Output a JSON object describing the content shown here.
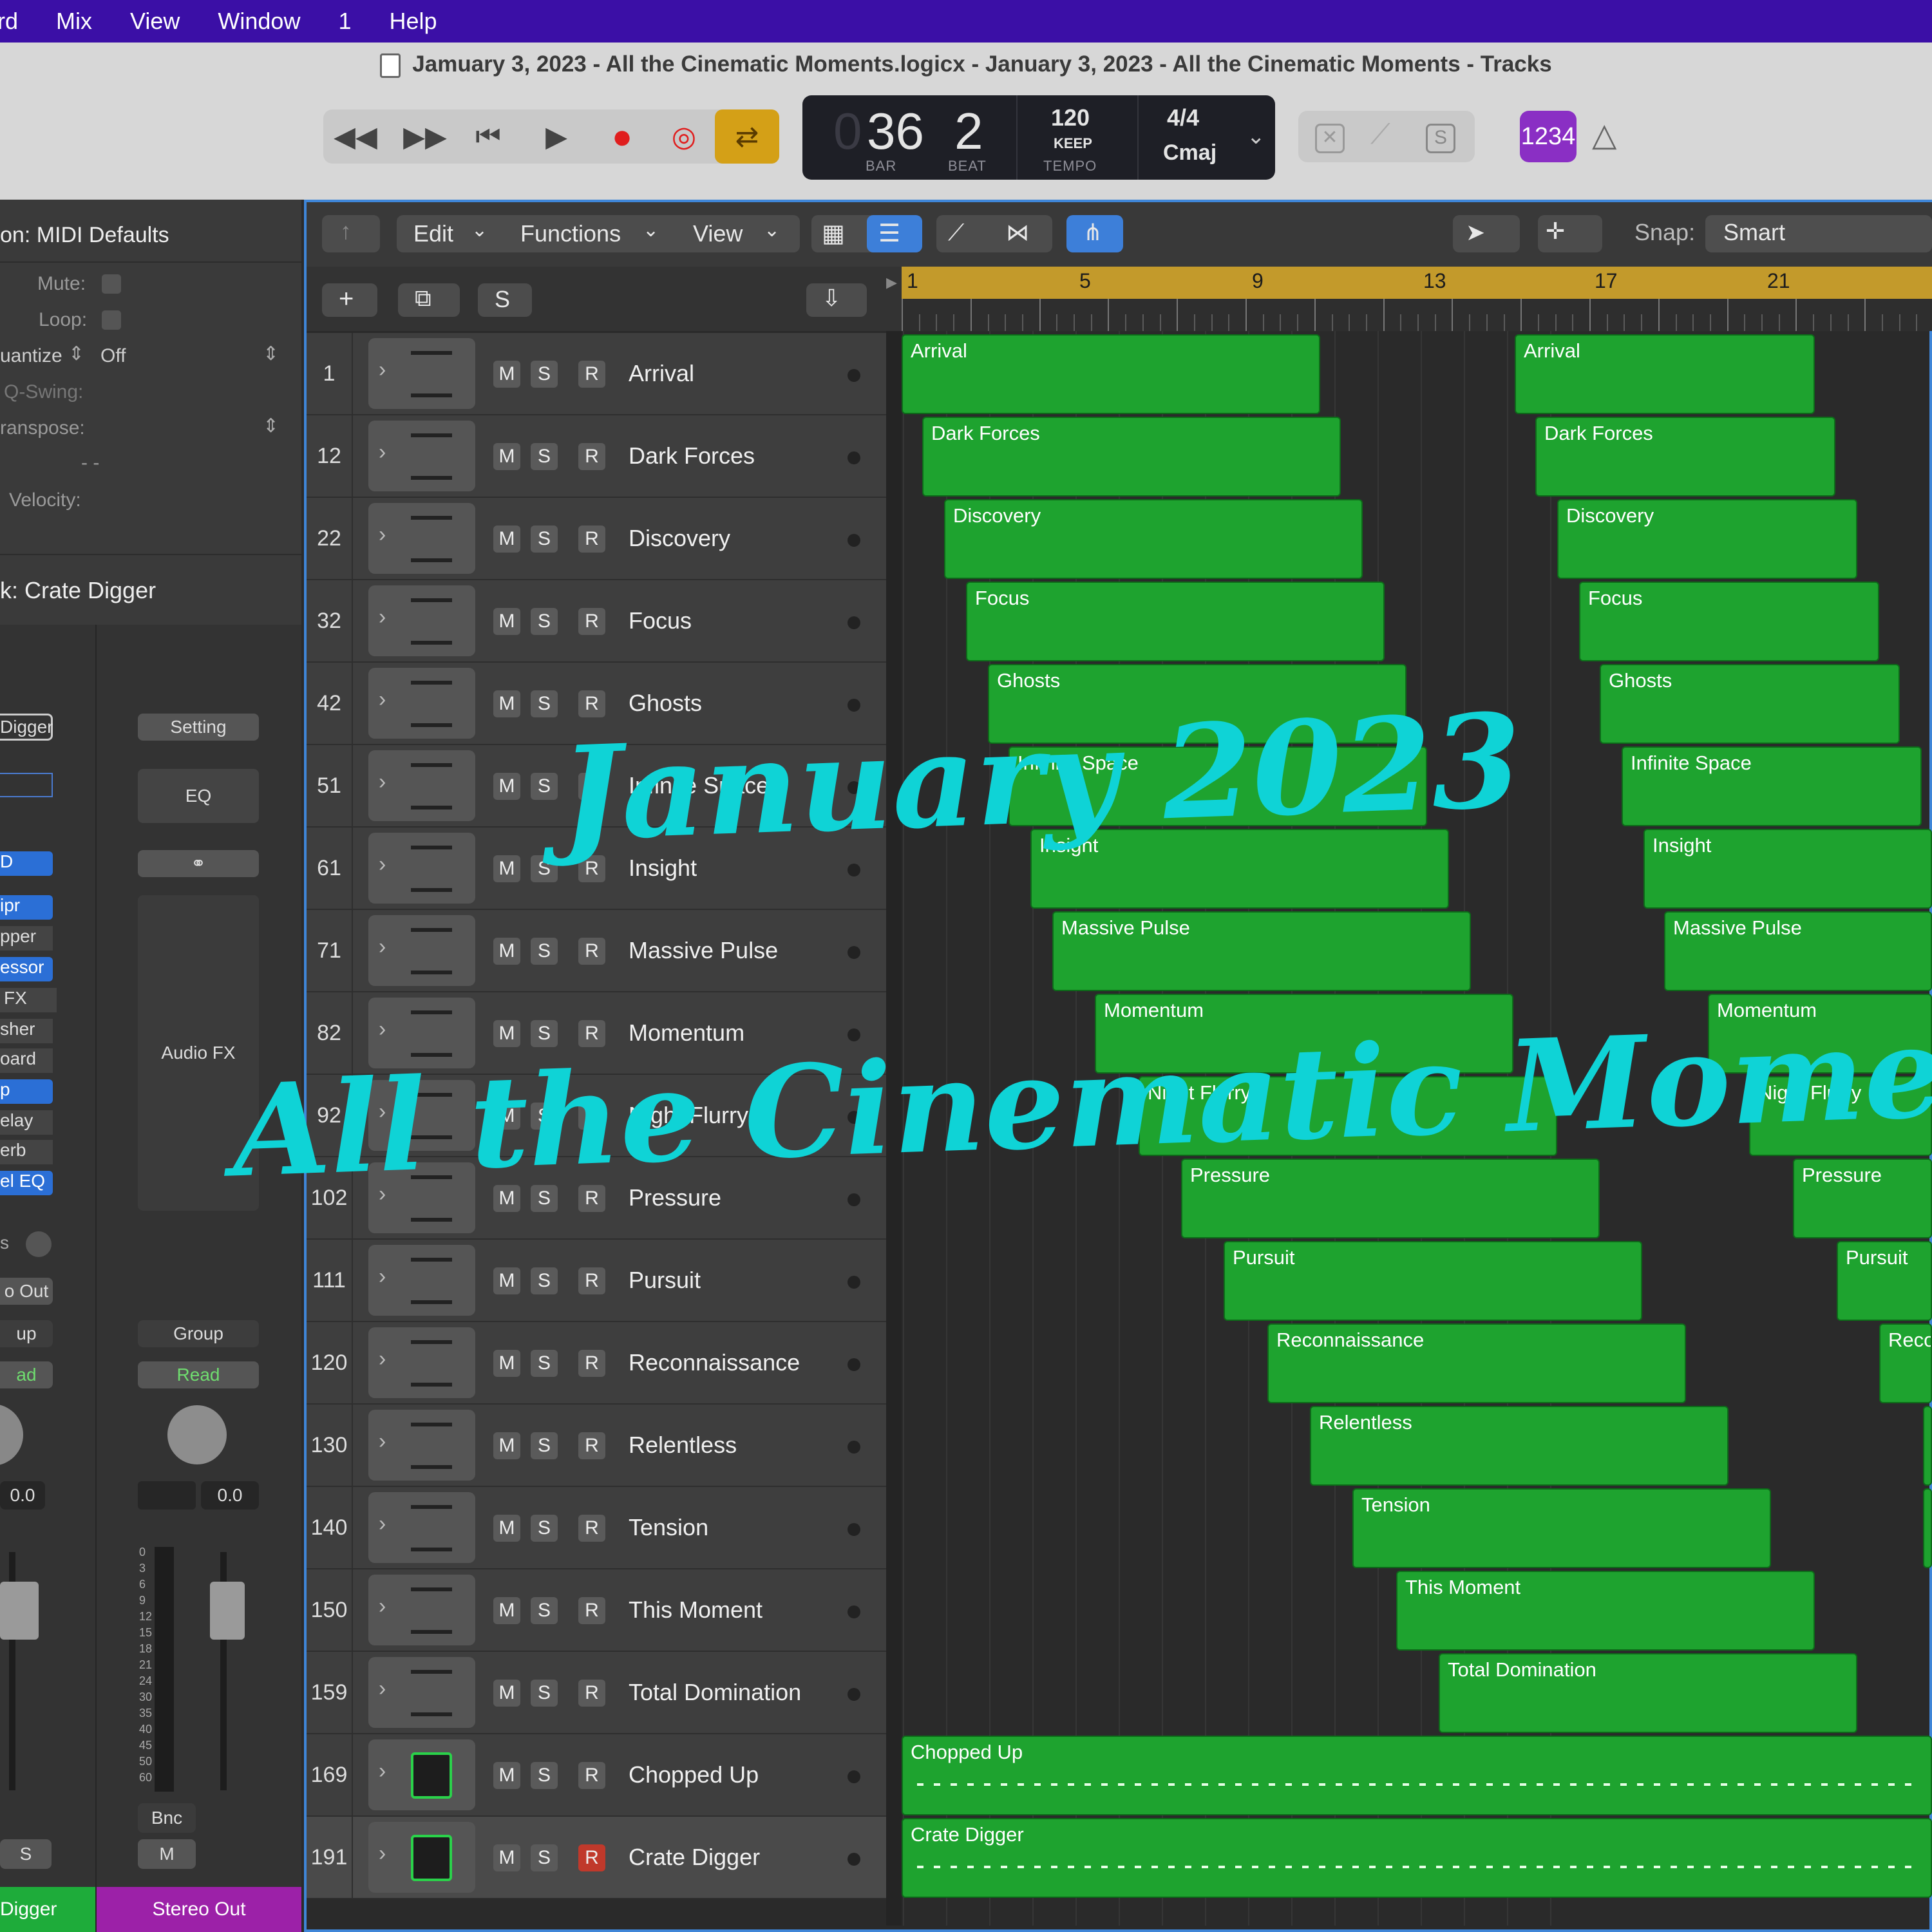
{
  "menubar": {
    "items": [
      "rd",
      "Mix",
      "View",
      "Window",
      "1",
      "Help"
    ]
  },
  "window": {
    "title": "Jamuary 3, 2023 - All the Cinematic Moments.logicx - January 3, 2023 - All the Cinematic Moments - Tracks"
  },
  "transport": {
    "buttons": [
      "rewind-icon",
      "fast-forward-icon",
      "go-to-start-icon",
      "play-icon",
      "record-icon",
      "capture-record-icon",
      "cycle-icon"
    ]
  },
  "lcd": {
    "bar_prefix": "0",
    "bar": "36",
    "beat": "2",
    "bar_label": "BAR",
    "beat_label": "BEAT",
    "tempo": "120",
    "keep_label": "KEEP",
    "tempo_label": "TEMPO",
    "signature": "4/4",
    "key": "Cmaj"
  },
  "controlbar_right": {
    "count_in": "1234",
    "buttons": [
      "list-editors-icon",
      "tuner-icon",
      "solo-icon",
      "metronome-icon"
    ]
  },
  "inspector": {
    "region_title": "on: MIDI Defaults",
    "mute": "Mute:",
    "loop": "Loop:",
    "quantize_label": "uantize",
    "quantize_value": "Off",
    "qswing": "Q-Swing:",
    "transpose": "ranspose:",
    "dashes": "- -",
    "velocity": "Velocity:",
    "track_title": "k:  Crate Digger",
    "strip1": {
      "setting": "Digger",
      "plugins": [
        "D",
        "ipr",
        "pper",
        "essor",
        "FX",
        "sher",
        "oard",
        "p",
        "elay",
        "erb",
        "el EQ"
      ],
      "s_label": "s",
      "out": "o Out",
      "group": "up",
      "read": "ad",
      "vol": "0.0",
      "solo": "S",
      "name": "Digger"
    },
    "strip2": {
      "setting": "Setting",
      "eq": "EQ",
      "audio_fx": "Audio FX",
      "group": "Group",
      "read": "Read",
      "vol": "0.0",
      "bnc": "Bnc",
      "mute": "M",
      "name": "Stereo Out",
      "scale": [
        "0",
        "3",
        "6",
        "9",
        "12",
        "15",
        "18",
        "21",
        "24",
        "30",
        "35",
        "40",
        "45",
        "50",
        "60"
      ]
    }
  },
  "toolbar": {
    "edit": "Edit",
    "functions": "Functions",
    "view": "View",
    "snap_label": "Snap:",
    "snap_value": "Smart"
  },
  "header": {
    "add": "+",
    "dup": "⧉",
    "s": "S"
  },
  "ruler": {
    "bars": [
      "1",
      "5",
      "9",
      "13",
      "17",
      "21"
    ]
  },
  "tracks": [
    {
      "num": "1",
      "name": "Arrival"
    },
    {
      "num": "12",
      "name": "Dark Forces"
    },
    {
      "num": "22",
      "name": "Discovery"
    },
    {
      "num": "32",
      "name": "Focus"
    },
    {
      "num": "42",
      "name": "Ghosts"
    },
    {
      "num": "51",
      "name": "Infinite Space"
    },
    {
      "num": "61",
      "name": "Insight"
    },
    {
      "num": "71",
      "name": "Massive Pulse"
    },
    {
      "num": "82",
      "name": "Momentum"
    },
    {
      "num": "92",
      "name": "Night Flurry"
    },
    {
      "num": "102",
      "name": "Pressure"
    },
    {
      "num": "111",
      "name": "Pursuit"
    },
    {
      "num": "120",
      "name": "Reconnaissance"
    },
    {
      "num": "130",
      "name": "Relentless"
    },
    {
      "num": "140",
      "name": "Tension"
    },
    {
      "num": "150",
      "name": "This Moment"
    },
    {
      "num": "159",
      "name": "Total Domination"
    },
    {
      "num": "169",
      "name": "Chopped Up"
    },
    {
      "num": "191",
      "name": "Crate Digger"
    }
  ],
  "track_buttons": {
    "mute": "M",
    "solo": "S",
    "rec": "R"
  },
  "regions": {
    "col1": [
      "Arrival",
      "Dark Forces",
      "Discovery",
      "Focus",
      "Ghosts",
      "Infinite Space",
      "Insight",
      "Massive Pulse",
      "Momentum",
      "Night Flurry",
      "Pressure",
      "Pursuit",
      "Reconnaissance",
      "Relentless",
      "Tension",
      "This Moment",
      "Total Domination"
    ],
    "col2": [
      "Arrival",
      "Dark Forces",
      "Discovery",
      "Focus",
      "Ghosts",
      "Infinite Space",
      "Insight",
      "Massive Pulse",
      "Momentum",
      "Night Flurry",
      "Pressure",
      "Pursuit",
      "Reco"
    ],
    "drums": [
      "Chopped Up",
      "Crate Digger"
    ]
  },
  "overlay": {
    "line1": "January 2023",
    "line2": "All the Cinematic Moments"
  },
  "colors": {
    "menubar": "#3b0fa6",
    "region": "#1ea32f",
    "overlay_text": "#0fd3d6",
    "ruler": "#c39a2b",
    "selection": "#3f86d8"
  }
}
